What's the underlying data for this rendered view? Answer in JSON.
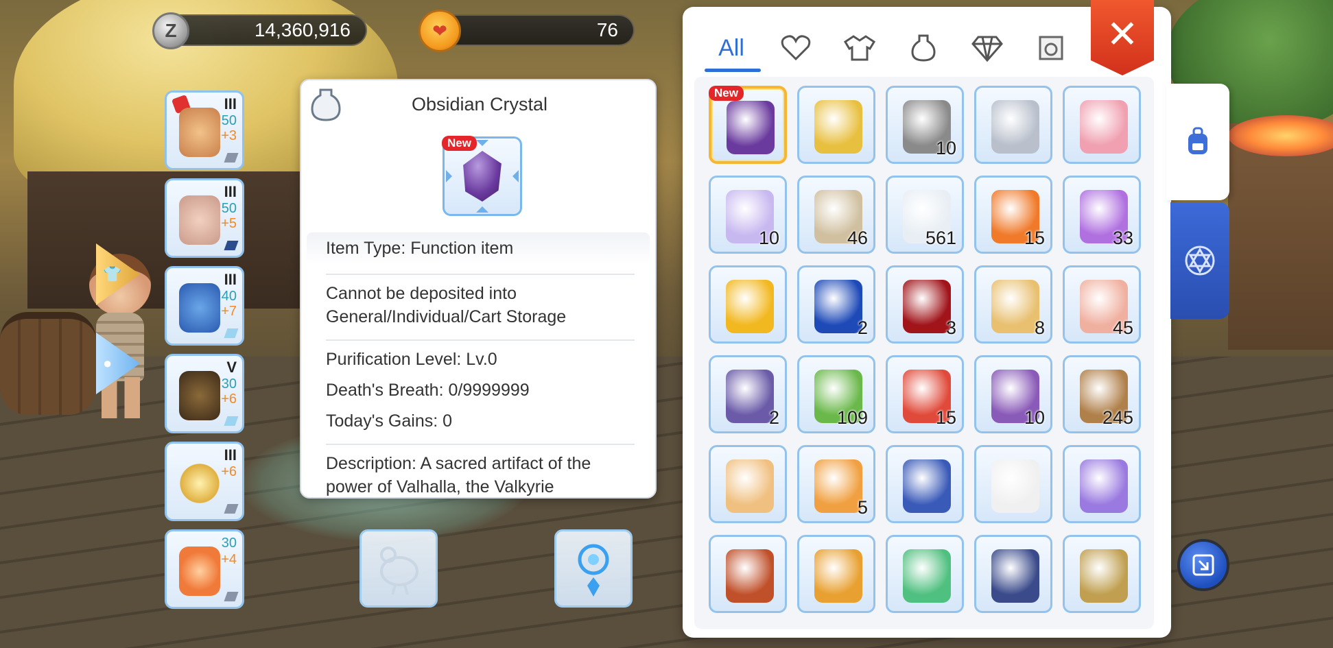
{
  "currency": {
    "zeny_icon_letter": "Z",
    "zeny_amount": "14,360,916",
    "gem_amount": "76"
  },
  "equipment": [
    {
      "name": "headgear",
      "tier": "III",
      "level": "50",
      "refine": "+3"
    },
    {
      "name": "armor",
      "tier": "III",
      "level": "50",
      "refine": "+5"
    },
    {
      "name": "cloak",
      "tier": "III",
      "level": "40",
      "refine": "+7"
    },
    {
      "name": "boots",
      "tier": "V",
      "level": "30",
      "refine": "+6"
    },
    {
      "name": "accessory",
      "tier": "III",
      "level": "",
      "refine": "+6"
    },
    {
      "name": "pet",
      "tier": "",
      "level": "30",
      "refine": "+4"
    }
  ],
  "tooltip": {
    "title": "Obsidian Crystal",
    "new_badge": "New",
    "item_type": "Item Type: Function item",
    "storage_line1": "Cannot be deposited into",
    "storage_line2": "General/Individual/Cart Storage",
    "purification": "Purification Level: Lv.0",
    "deaths_breath": "Death's Breath: 0/9999999",
    "todays_gains": "Today's Gains: 0",
    "description_line1": "Description: A sacred artifact of the",
    "description_line2": "power of Valhalla, the Valkyrie"
  },
  "inventory": {
    "tabs": [
      {
        "label": "All",
        "icon": "all"
      },
      {
        "label": "",
        "icon": "heart-icon"
      },
      {
        "label": "",
        "icon": "armor-icon"
      },
      {
        "label": "",
        "icon": "potion-icon"
      },
      {
        "label": "",
        "icon": "gem-icon"
      },
      {
        "label": "",
        "icon": "card-icon"
      }
    ],
    "close_label": "✕",
    "new_badge": "New",
    "items": [
      {
        "name": "obsidian-crystal",
        "count": ""
      },
      {
        "name": "ticket",
        "count": ""
      },
      {
        "name": "vending-sign",
        "count": "10"
      },
      {
        "name": "disc",
        "count": ""
      },
      {
        "name": "angel-wing-item",
        "count": ""
      },
      {
        "name": "potion-bottle",
        "count": "10"
      },
      {
        "name": "butterfly-wing",
        "count": "46"
      },
      {
        "name": "white-feather",
        "count": "561"
      },
      {
        "name": "blue-horn",
        "count": "15"
      },
      {
        "name": "purple-butterfly",
        "count": "33"
      },
      {
        "name": "gold-card",
        "count": ""
      },
      {
        "name": "blue-shield-card",
        "count": "2"
      },
      {
        "name": "red-sword-card",
        "count": "3"
      },
      {
        "name": "scroll",
        "count": "8"
      },
      {
        "name": "goblet",
        "count": "45"
      },
      {
        "name": "purple-book",
        "count": "2"
      },
      {
        "name": "green-leaf",
        "count": "109"
      },
      {
        "name": "red-gift-box",
        "count": "15"
      },
      {
        "name": "purple-gift-box",
        "count": "10"
      },
      {
        "name": "coin-sack",
        "count": "245"
      },
      {
        "name": "winged-gift-box",
        "count": ""
      },
      {
        "name": "star-badge",
        "count": "5"
      },
      {
        "name": "blue-tome",
        "count": ""
      },
      {
        "name": "pink-orb-box",
        "count": ""
      },
      {
        "name": "smiley-book",
        "count": ""
      },
      {
        "name": "red-tome",
        "count": ""
      },
      {
        "name": "crystal-orb",
        "count": ""
      },
      {
        "name": "cat-card",
        "count": ""
      },
      {
        "name": "open-book",
        "count": ""
      },
      {
        "name": "golden-statue",
        "count": ""
      }
    ]
  },
  "colors": {
    "accent_blue": "#2d6fd4",
    "close_red": "#e0442a",
    "count_orange": "#f08a2a",
    "level_teal": "#2a9fb6"
  }
}
